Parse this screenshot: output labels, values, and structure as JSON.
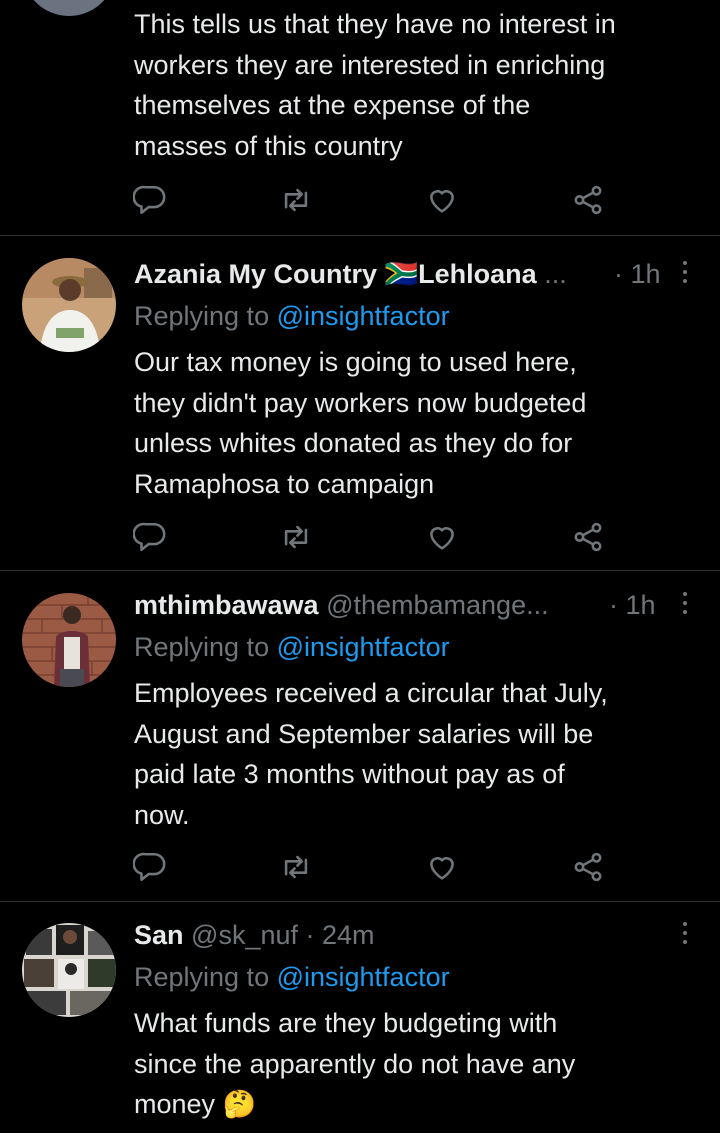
{
  "colors": {
    "background": "#000000",
    "text": "#e7e9ea",
    "muted": "#71767b",
    "link": "#1d9bf0",
    "divider": "#2f3336"
  },
  "icons": {
    "reply": "reply-icon",
    "retweet": "retweet-icon",
    "like": "like-icon",
    "share": "share-icon",
    "more": "more-icon"
  },
  "tweets": [
    {
      "lines": [
        "This tells us that they have no interest in",
        "workers they are interested in enriching",
        "themselves at the expense of the",
        "masses of this country"
      ]
    },
    {
      "name": "Azania My Country",
      "flag": "🇿🇦",
      "name_tail": "Lehloana",
      "handle": "...",
      "time": "· 1h",
      "reply_prefix": "Replying to ",
      "reply_to": "@insightfactor",
      "lines": [
        "Our tax money is going to used here,",
        "they didn't pay workers now budgeted",
        "unless whites donated as they do for",
        "Ramaphosa to campaign"
      ]
    },
    {
      "name": "mthimbawawa",
      "handle": "@thembamange...",
      "time": "· 1h",
      "reply_prefix": "Replying to ",
      "reply_to": "@insightfactor",
      "lines": [
        "Employees received a circular  that July,",
        "August and September  salaries will be",
        "paid late  3 months without pay as of",
        "now."
      ]
    },
    {
      "name": "San",
      "handle": "@sk_nuf",
      "time": "· 24m",
      "reply_prefix": "Replying to ",
      "reply_to": "@insightfactor",
      "lines": [
        "What funds are they budgeting with",
        "since the apparently do not have any",
        "money"
      ],
      "emoji": "🤔"
    }
  ]
}
